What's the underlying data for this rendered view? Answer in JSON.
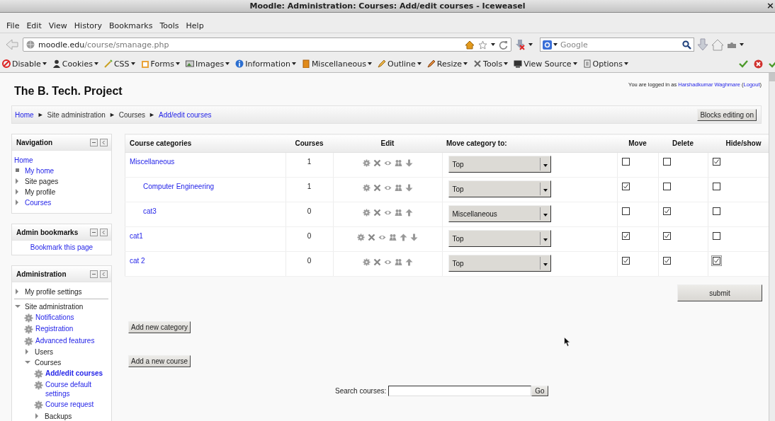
{
  "window": {
    "title": "Moodle: Administration: Courses: Add/edit courses - Iceweasel",
    "close": "×"
  },
  "menu_bar": [
    "File",
    "Edit",
    "View",
    "History",
    "Bookmarks",
    "Tools",
    "Help"
  ],
  "address_bar": {
    "host": "moodle.edu",
    "path": "/course/smanage.php"
  },
  "web_search": {
    "placeholder": "Google"
  },
  "dev_toolbar": [
    "Disable",
    "Cookies",
    "CSS",
    "Forms",
    "Images",
    "Information",
    "Miscellaneous",
    "Outline",
    "Resize",
    "Tools",
    "View Source",
    "Options"
  ],
  "page": {
    "site_title": "The B. Tech. Project",
    "login": {
      "text": "You are logged in as",
      "user": "Harshadkumar Waghmare",
      "open": "(",
      "logout": "Logout",
      "close": ")"
    },
    "breadcrumb": [
      {
        "kind": "link",
        "label": "Home"
      },
      {
        "kind": "sep",
        "label": "►"
      },
      {
        "kind": "text",
        "label": "Site administration"
      },
      {
        "kind": "sep",
        "label": "►"
      },
      {
        "kind": "text",
        "label": "Courses"
      },
      {
        "kind": "sep",
        "label": "►"
      },
      {
        "kind": "link",
        "label": "Add/edit courses"
      }
    ],
    "blocks_button": "Blocks editing on"
  },
  "sidebar": {
    "navigation": {
      "title": "Navigation",
      "items": [
        {
          "kind": "plain",
          "label": "Home",
          "link": true
        },
        {
          "kind": "leaf",
          "label": "My home",
          "link": true
        },
        {
          "kind": "branch",
          "label": "Site pages",
          "link": false,
          "expanded": false
        },
        {
          "kind": "branch",
          "label": "My profile",
          "link": false,
          "expanded": false
        },
        {
          "kind": "branch",
          "label": "Courses",
          "link": true,
          "expanded": false
        }
      ]
    },
    "admin_bookmarks": {
      "title": "Admin bookmarks",
      "link": "Bookmark this page"
    },
    "administration": {
      "title": "Administration",
      "items": [
        {
          "kind": "branch",
          "label": "My profile settings",
          "link": false,
          "expanded": false
        },
        {
          "kind": "branch",
          "label": "Site administration",
          "link": false,
          "expanded": true,
          "children": [
            {
              "kind": "setting",
              "label": "Notifications",
              "link": true,
              "selected": false
            },
            {
              "kind": "setting",
              "label": "Registration",
              "link": true,
              "selected": false
            },
            {
              "kind": "setting",
              "label": "Advanced features",
              "link": true,
              "selected": false
            },
            {
              "kind": "branch",
              "label": "Users",
              "link": false,
              "expanded": false
            },
            {
              "kind": "branch",
              "label": "Courses",
              "link": false,
              "expanded": true,
              "children": [
                {
                  "kind": "setting",
                  "label": "Add/edit courses",
                  "link": true,
                  "selected": true
                },
                {
                  "kind": "setting",
                  "label": "Course default settings",
                  "link": true,
                  "selected": false
                },
                {
                  "kind": "setting",
                  "label": "Course request",
                  "link": true,
                  "selected": false
                },
                {
                  "kind": "branch",
                  "label": "Backups",
                  "link": false,
                  "expanded": false
                }
              ]
            }
          ]
        }
      ]
    }
  },
  "table": {
    "columns": [
      "Course categories",
      "Courses",
      "Edit",
      "Move category to:",
      "Move",
      "Delete",
      "Hide/show"
    ],
    "rows": [
      {
        "name": "Miscellaneous",
        "courses": "1",
        "edit_icons": [
          {
            "kind": "gear"
          },
          {
            "kind": "cross"
          },
          {
            "kind": "eye"
          },
          {
            "kind": "people"
          },
          {
            "kind": "down"
          }
        ],
        "move_to": "Top",
        "move": false,
        "delete": false,
        "hide": true,
        "hide_focused": false,
        "children": [
          {
            "name": "Computer Engineering",
            "courses": "1",
            "edit_icons": [
              {
                "kind": "gear"
              },
              {
                "kind": "cross"
              },
              {
                "kind": "eye"
              },
              {
                "kind": "people"
              },
              {
                "kind": "down"
              }
            ],
            "move_to": "Top",
            "move": true,
            "delete": false,
            "hide": false,
            "hide_focused": false
          },
          {
            "name": "cat3",
            "courses": "0",
            "edit_icons": [
              {
                "kind": "gear"
              },
              {
                "kind": "cross"
              },
              {
                "kind": "eye"
              },
              {
                "kind": "people"
              },
              {
                "kind": "up"
              }
            ],
            "move_to": "Miscellaneous",
            "move": false,
            "delete": true,
            "hide": false,
            "hide_focused": false
          }
        ]
      },
      {
        "name": "cat1",
        "courses": "0",
        "edit_icons": [
          {
            "kind": "gear"
          },
          {
            "kind": "cross"
          },
          {
            "kind": "eye"
          },
          {
            "kind": "people"
          },
          {
            "kind": "up"
          },
          {
            "kind": "down"
          }
        ],
        "move_to": "Top",
        "move": true,
        "delete": true,
        "hide": false,
        "hide_focused": false
      },
      {
        "name": "cat 2",
        "courses": "0",
        "edit_icons": [
          {
            "kind": "gear"
          },
          {
            "kind": "cross"
          },
          {
            "kind": "eye"
          },
          {
            "kind": "people"
          },
          {
            "kind": "up"
          }
        ],
        "move_to": "Top",
        "move": true,
        "delete": true,
        "hide": true,
        "hide_focused": true
      }
    ]
  },
  "submit_button": "submit",
  "add_category_button": "Add new category",
  "add_course_button": "Add a new course",
  "search": {
    "label": "Search courses:",
    "button": "Go"
  }
}
